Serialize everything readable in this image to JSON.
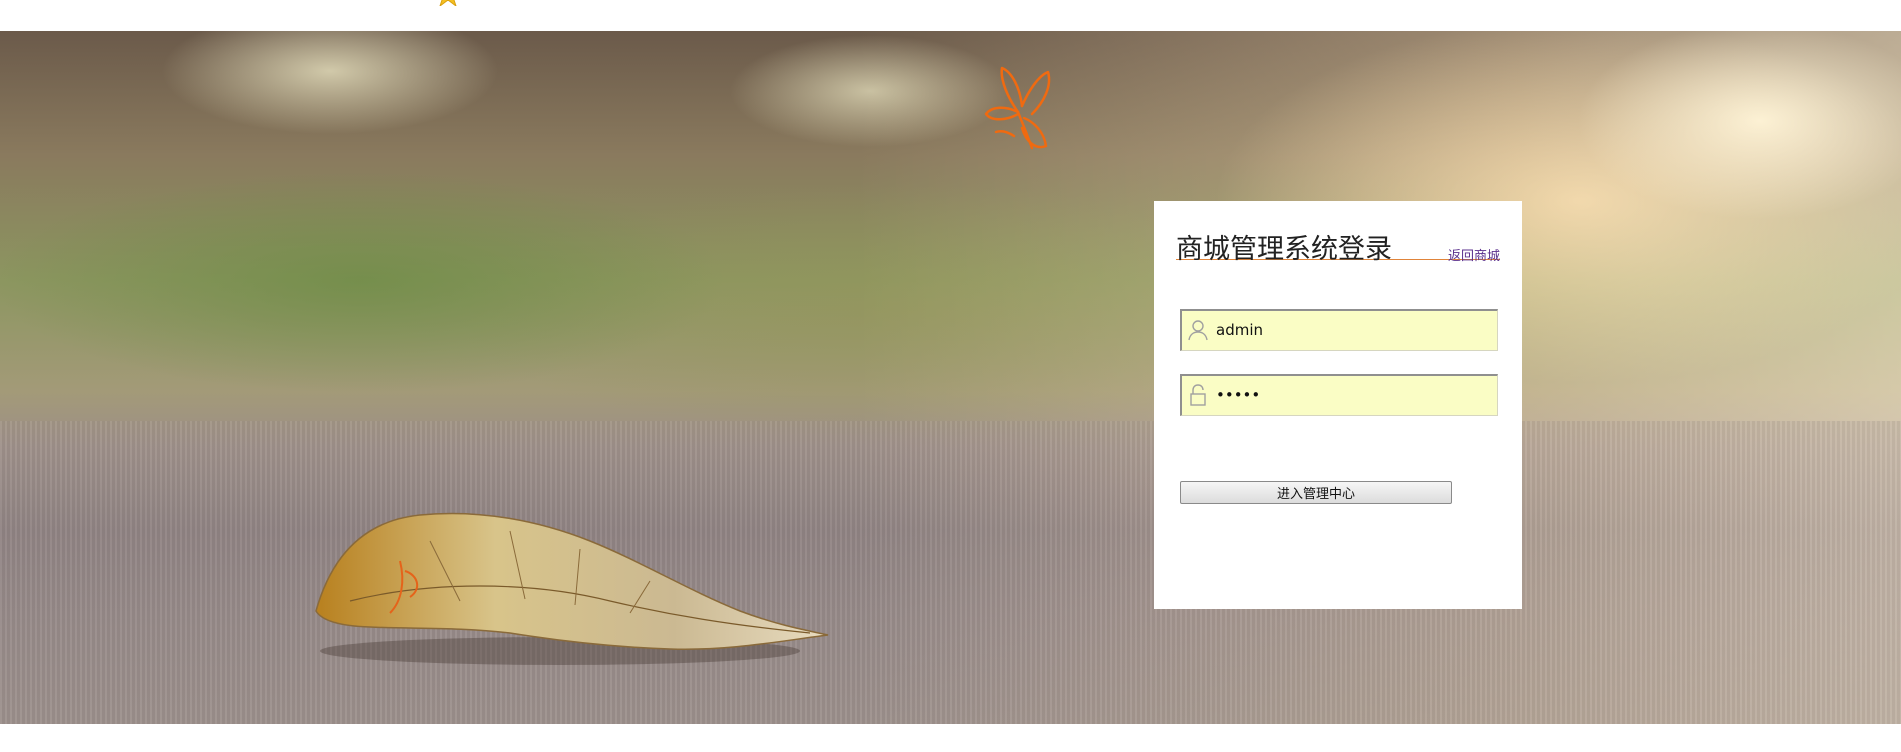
{
  "login": {
    "title": "商城管理系统登录",
    "back_link": "返回商城",
    "username": {
      "value": "admin",
      "icon": "user-icon"
    },
    "password": {
      "value": "•••••",
      "icon": "lock-icon"
    },
    "submit_label": "进入管理中心"
  },
  "decor": {
    "butterfly_color": "#f06a10",
    "star_color": "#f5c020",
    "card_divider_color": "#e0843a",
    "link_color": "#5a2f8c",
    "input_bg": "#fafdc5",
    "icons": [
      "star-icon",
      "butterfly-icon",
      "leaf-image"
    ]
  }
}
